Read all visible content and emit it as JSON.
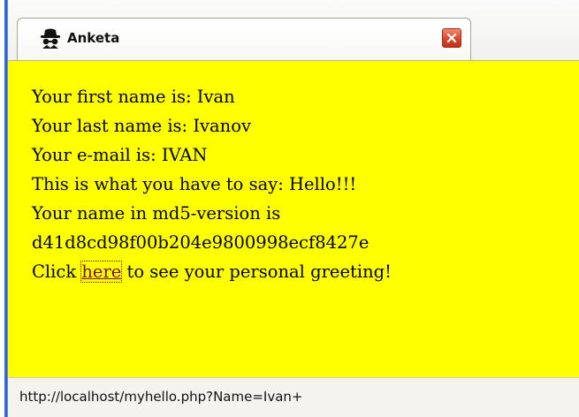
{
  "tab": {
    "title": "Anketa",
    "icon": "spy-hat-icon",
    "close_icon": "close-icon",
    "close_color": "#d9462a"
  },
  "content": {
    "background": "#ffff00",
    "first_name_text": "Your first name is: Ivan",
    "last_name_text": "Your last name is: Ivanov",
    "email_text": "Your e-mail is: IVAN",
    "say_text": "This is what you have to say: Hello!!!",
    "md5_label": "Your name in md5-version is",
    "md5_value": "d41d8cd98f00b204e9800998ecf8427e",
    "greeting_prefix": "Click ",
    "greeting_link": "here",
    "greeting_suffix": " to see your personal greeting!"
  },
  "status_bar": {
    "text": "http://localhost/myhello.php?Name=Ivan+"
  }
}
